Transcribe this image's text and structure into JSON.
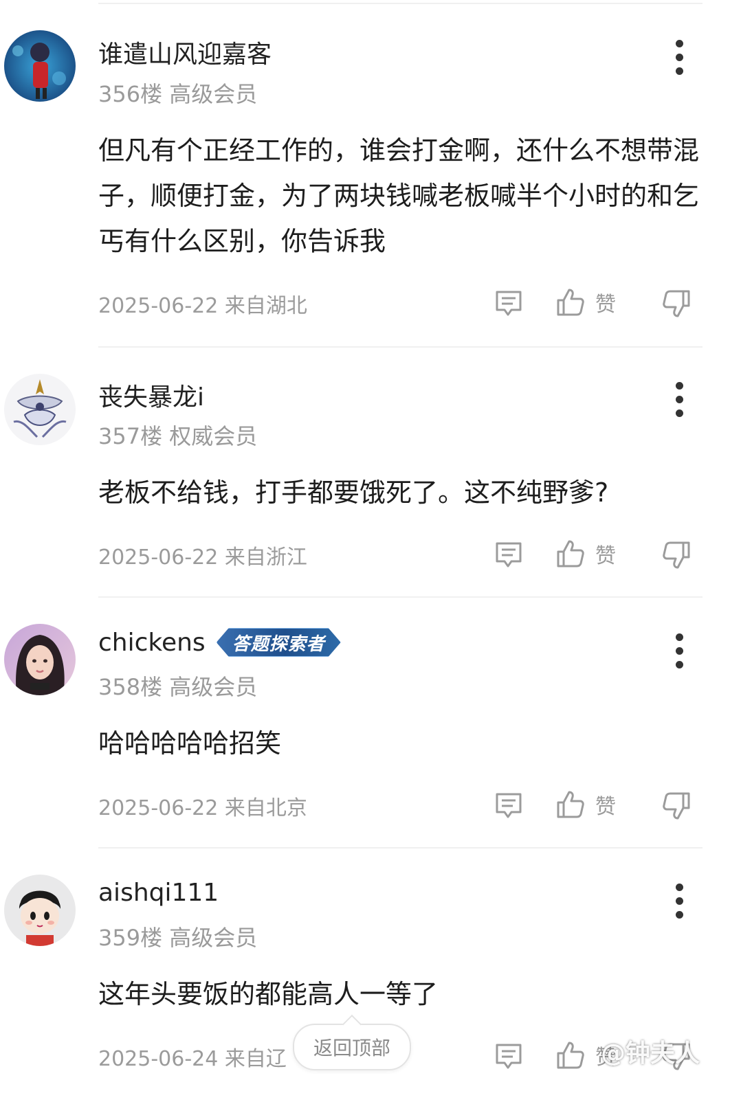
{
  "posts": [
    {
      "username": "谁遣山风迎嘉客",
      "floor": "356楼",
      "level": "高级会员",
      "content": "但凡有个正经工作的，谁会打金啊，还什么不想带混子，顺便打金，为了两块钱喊老板喊半个小时的和乞丐有什么区别，你告诉我",
      "date": "2025-06-22",
      "location": "来自湖北",
      "like_label": "赞"
    },
    {
      "username": "丧失暴龙i",
      "floor": "357楼",
      "level": "权威会员",
      "content": "老板不给钱，打手都要饿死了。这不纯野爹?",
      "date": "2025-06-22",
      "location": "来自浙江",
      "like_label": "赞"
    },
    {
      "username": "chickens",
      "badge": "答题探索者",
      "floor": "358楼",
      "level": "高级会员",
      "content": "哈哈哈哈哈招笑",
      "date": "2025-06-22",
      "location": "来自北京",
      "like_label": "赞"
    },
    {
      "username": "aishqi111",
      "floor": "359楼",
      "level": "高级会员",
      "content": "这年头要饭的都能高人一等了",
      "date": "2025-06-24",
      "location": "来自辽",
      "like_label": "赞"
    }
  ],
  "back_to_top": "返回顶部",
  "watermark": "@钟夫人",
  "icons": {
    "more": "more-vertical-icon",
    "reply": "comment-icon",
    "like": "thumbs-up-icon",
    "dislike": "thumbs-down-icon"
  },
  "colors": {
    "text": "#1d1d1d",
    "meta": "#9a9a9a",
    "divider": "#f0f0f0",
    "badge": "#1f4f8c"
  }
}
